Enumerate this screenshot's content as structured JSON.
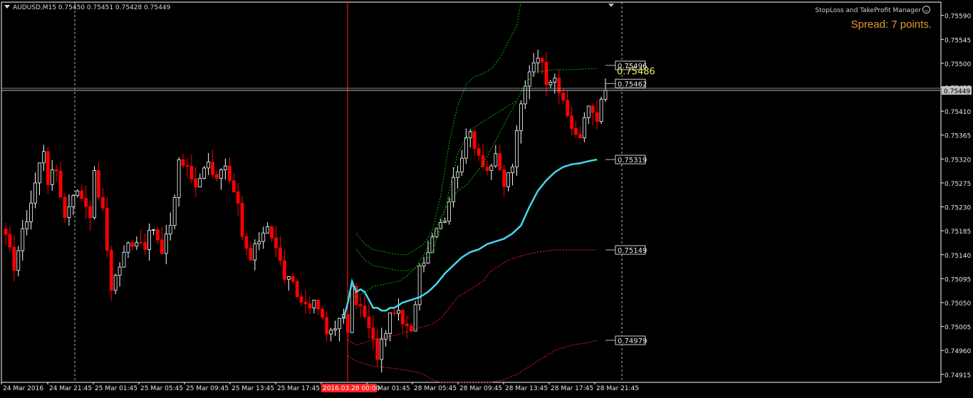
{
  "header": {
    "symbol_info": "AUDUSD,M15  0.75450 0.75451 0.75428 0.75449"
  },
  "expert": {
    "name": "StopLoss and TakeProfit Manager",
    "icon": "smiley-icon"
  },
  "spread_text": "Spread: 7 points.",
  "colors": {
    "background": "#000000",
    "axis": "#ffffff",
    "bull_candle": "#ffffff",
    "bear_candle": "#ff0000",
    "ma_line": "#44d8ee",
    "upper_envelope": "#00c000",
    "lower_envelope": "#ff2020",
    "price_tag_bg": "#c0c0c0",
    "period_marker": "#ff2020"
  },
  "chart_data": {
    "type": "candlestick",
    "symbol": "AUDUSD",
    "timeframe": "M15",
    "ylim": [
      0.749,
      0.75615
    ],
    "y_ticks": [
      "0.75590",
      "0.75545",
      "0.75500",
      "0.75455",
      "0.75410",
      "0.75365",
      "0.75320",
      "0.75275",
      "0.75230",
      "0.75185",
      "0.75140",
      "0.75095",
      "0.75050",
      "0.75005",
      "0.74960",
      "0.74915"
    ],
    "x_ticks": [
      "24 Mar 2016",
      "24 Mar 21:45",
      "25 Mar 01:45",
      "25 Mar 05:45",
      "25 Mar 09:45",
      "25 Mar 13:45",
      "25 Mar 17:45",
      "2016.03.28 00:00",
      "28 Mar 01:45",
      "28 Mar 05:45",
      "28 Mar 09:45",
      "28 Mar 13:45",
      "28 Mar 17:45",
      "28 Mar 21:45"
    ],
    "highlighted_tick": "2016.03.28 00:00",
    "visible_tick_text": {
      "2016.03.28 00:00": "2016.03.28 00:00",
      "28 Mar 01:45": "Mar 01:45"
    },
    "current_price": "0.75449",
    "price_labels": [
      "0.75496",
      "0.75462",
      "0.75319",
      "0.75149",
      "0.74979"
    ],
    "overlay_value": "0.75486",
    "candle_path": [
      [
        0,
        0.7517
      ],
      [
        2,
        0.7512
      ],
      [
        4,
        0.7518
      ],
      [
        6,
        0.7524
      ],
      [
        8,
        0.7531
      ],
      [
        9,
        0.7534
      ],
      [
        10,
        0.7528
      ],
      [
        12,
        0.753
      ],
      [
        14,
        0.7521
      ],
      [
        16,
        0.7526
      ],
      [
        18,
        0.7525
      ],
      [
        20,
        0.7522
      ],
      [
        21,
        0.7529
      ],
      [
        23,
        0.7522
      ],
      [
        25,
        0.7508
      ],
      [
        27,
        0.7512
      ],
      [
        29,
        0.7516
      ],
      [
        31,
        0.7517
      ],
      [
        33,
        0.7516
      ],
      [
        35,
        0.7519
      ],
      [
        37,
        0.7514
      ],
      [
        39,
        0.752
      ],
      [
        40,
        0.7525
      ],
      [
        41,
        0.7532
      ],
      [
        43,
        0.753
      ],
      [
        45,
        0.7527
      ],
      [
        47,
        0.7531
      ],
      [
        48,
        0.7531
      ],
      [
        50,
        0.7529
      ],
      [
        52,
        0.753
      ],
      [
        53,
        0.7527
      ],
      [
        55,
        0.7523
      ],
      [
        56,
        0.7517
      ],
      [
        58,
        0.7513
      ],
      [
        60,
        0.7517
      ],
      [
        62,
        0.752
      ],
      [
        64,
        0.7515
      ],
      [
        66,
        0.751
      ],
      [
        68,
        0.7508
      ],
      [
        70,
        0.7505
      ],
      [
        72,
        0.7505
      ],
      [
        74,
        0.7504
      ],
      [
        76,
        0.7499
      ],
      [
        78,
        0.7501
      ],
      [
        80,
        0.7502
      ],
      [
        81,
        0.75
      ],
      [
        82,
        0.7507
      ],
      [
        84,
        0.7504
      ],
      [
        86,
        0.75
      ],
      [
        88,
        0.7495
      ],
      [
        90,
        0.75
      ],
      [
        92,
        0.7504
      ],
      [
        94,
        0.7501
      ],
      [
        96,
        0.7499
      ],
      [
        98,
        0.7512
      ],
      [
        100,
        0.7515
      ],
      [
        102,
        0.752
      ],
      [
        104,
        0.7521
      ],
      [
        106,
        0.7528
      ],
      [
        108,
        0.7533
      ],
      [
        110,
        0.7537
      ],
      [
        112,
        0.7533
      ],
      [
        114,
        0.753
      ],
      [
        116,
        0.7532
      ],
      [
        118,
        0.7527
      ],
      [
        120,
        0.7531
      ],
      [
        122,
        0.7542
      ],
      [
        124,
        0.7549
      ],
      [
        126,
        0.7552
      ],
      [
        128,
        0.7547
      ],
      [
        130,
        0.7548
      ],
      [
        132,
        0.7542
      ],
      [
        134,
        0.7538
      ],
      [
        136,
        0.7536
      ],
      [
        138,
        0.7542
      ],
      [
        140,
        0.754
      ],
      [
        142,
        0.75449
      ]
    ],
    "ma_series": [
      [
        80,
        0.7502
      ],
      [
        81,
        0.7505
      ],
      [
        82,
        0.7509
      ],
      [
        83,
        0.7507
      ],
      [
        84,
        0.75075
      ],
      [
        85,
        0.7507
      ],
      [
        86,
        0.75055
      ],
      [
        87,
        0.7504
      ],
      [
        88,
        0.7504
      ],
      [
        89,
        0.75035
      ],
      [
        90,
        0.75035
      ],
      [
        91,
        0.7504
      ],
      [
        92,
        0.7504
      ],
      [
        93,
        0.75045
      ],
      [
        94,
        0.7505
      ],
      [
        96,
        0.75055
      ],
      [
        98,
        0.7506
      ],
      [
        100,
        0.7507
      ],
      [
        102,
        0.75085
      ],
      [
        104,
        0.75105
      ],
      [
        106,
        0.7512
      ],
      [
        108,
        0.75135
      ],
      [
        110,
        0.75145
      ],
      [
        112,
        0.7515
      ],
      [
        114,
        0.7516
      ],
      [
        116,
        0.75165
      ],
      [
        118,
        0.7517
      ],
      [
        120,
        0.7518
      ],
      [
        122,
        0.75195
      ],
      [
        124,
        0.7523
      ],
      [
        126,
        0.7526
      ],
      [
        128,
        0.7528
      ],
      [
        130,
        0.75295
      ],
      [
        132,
        0.75305
      ],
      [
        134,
        0.7531
      ],
      [
        136,
        0.75312
      ],
      [
        138,
        0.75316
      ],
      [
        140,
        0.75319
      ]
    ],
    "upper_band_outer": [
      [
        83,
        0.7518
      ],
      [
        85,
        0.7516
      ],
      [
        87,
        0.7515
      ],
      [
        90,
        0.75145
      ],
      [
        93,
        0.7514
      ],
      [
        95,
        0.7514
      ],
      [
        97,
        0.7515
      ],
      [
        99,
        0.7516
      ],
      [
        101,
        0.75185
      ],
      [
        103,
        0.7525
      ],
      [
        105,
        0.7535
      ],
      [
        107,
        0.7542
      ],
      [
        109,
        0.7546
      ],
      [
        111,
        0.75475
      ],
      [
        113,
        0.7548
      ],
      [
        115,
        0.7549
      ],
      [
        117,
        0.7551
      ],
      [
        119,
        0.7554
      ],
      [
        121,
        0.7557
      ],
      [
        122,
        0.75615
      ]
    ],
    "upper_band_inner": [
      [
        83,
        0.7515
      ],
      [
        85,
        0.7513
      ],
      [
        87,
        0.7512
      ],
      [
        90,
        0.75115
      ],
      [
        93,
        0.7511
      ],
      [
        95,
        0.7511
      ],
      [
        97,
        0.75115
      ],
      [
        99,
        0.75125
      ],
      [
        101,
        0.75145
      ],
      [
        103,
        0.7519
      ],
      [
        105,
        0.7526
      ],
      [
        107,
        0.7533
      ],
      [
        109,
        0.7536
      ],
      [
        111,
        0.7538
      ],
      [
        113,
        0.7539
      ],
      [
        115,
        0.754
      ],
      [
        117,
        0.7541
      ],
      [
        119,
        0.7542
      ],
      [
        121,
        0.7543
      ]
    ],
    "upper_band_far": [
      [
        81,
        0.7507
      ],
      [
        83,
        0.7506
      ],
      [
        85,
        0.7507
      ],
      [
        87,
        0.7508
      ],
      [
        90,
        0.75085
      ],
      [
        93,
        0.7509
      ],
      [
        95,
        0.751
      ],
      [
        97,
        0.75115
      ],
      [
        99,
        0.7514
      ],
      [
        101,
        0.7517
      ],
      [
        103,
        0.7521
      ],
      [
        105,
        0.7524
      ],
      [
        107,
        0.7526
      ],
      [
        109,
        0.7527
      ],
      [
        111,
        0.7529
      ],
      [
        113,
        0.7531
      ],
      [
        115,
        0.7534
      ],
      [
        117,
        0.7537
      ],
      [
        119,
        0.754
      ],
      [
        121,
        0.7543
      ],
      [
        123,
        0.7546
      ],
      [
        125,
        0.7548
      ],
      [
        127,
        0.75485
      ],
      [
        130,
        0.75488
      ],
      [
        134,
        0.75488
      ],
      [
        138,
        0.7549
      ],
      [
        140,
        0.7549
      ]
    ],
    "lower_band_outer": [
      [
        81,
        0.7498
      ],
      [
        83,
        0.7497
      ],
      [
        85,
        0.74975
      ],
      [
        87,
        0.7498
      ],
      [
        90,
        0.74985
      ],
      [
        93,
        0.7499
      ],
      [
        95,
        0.74995
      ],
      [
        97,
        0.75
      ],
      [
        99,
        0.75005
      ],
      [
        101,
        0.7501
      ],
      [
        103,
        0.7502
      ],
      [
        105,
        0.7504
      ],
      [
        107,
        0.7506
      ],
      [
        109,
        0.7507
      ],
      [
        111,
        0.7508
      ],
      [
        113,
        0.7509
      ],
      [
        115,
        0.7511
      ],
      [
        117,
        0.7512
      ],
      [
        119,
        0.7513
      ],
      [
        121,
        0.75135
      ],
      [
        123,
        0.7514
      ],
      [
        126,
        0.75145
      ],
      [
        130,
        0.75149
      ],
      [
        134,
        0.75149
      ],
      [
        140,
        0.75149
      ]
    ],
    "lower_band_far": [
      [
        81,
        0.7495
      ],
      [
        83,
        0.7494
      ],
      [
        85,
        0.74935
      ],
      [
        87,
        0.7493
      ],
      [
        90,
        0.74928
      ],
      [
        93,
        0.74925
      ],
      [
        95,
        0.74922
      ],
      [
        97,
        0.7492
      ],
      [
        99,
        0.74915
      ],
      [
        101,
        0.74905
      ],
      [
        103,
        0.749
      ],
      [
        115,
        0.749
      ],
      [
        118,
        0.74905
      ],
      [
        121,
        0.74915
      ],
      [
        124,
        0.7493
      ],
      [
        127,
        0.74945
      ],
      [
        130,
        0.7496
      ],
      [
        134,
        0.7497
      ],
      [
        138,
        0.74975
      ],
      [
        140,
        0.74979
      ]
    ]
  }
}
